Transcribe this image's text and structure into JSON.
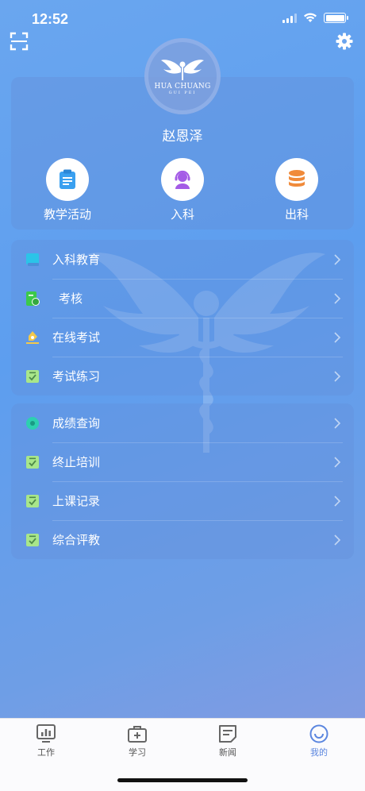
{
  "status_bar": {
    "time": "12:52"
  },
  "header": {
    "logo_text": "HUA CHUANG",
    "logo_sub": "GUI PEI"
  },
  "profile": {
    "name": "赵恩泽",
    "quick_actions": [
      {
        "label": "教学活动",
        "icon": "clipboard-icon",
        "color": "#3aa0f0"
      },
      {
        "label": "入科",
        "icon": "headset-person-icon",
        "color": "#a45be6"
      },
      {
        "label": "出科",
        "icon": "database-stack-icon",
        "color": "#f08a3a"
      }
    ]
  },
  "menu_group_1": [
    {
      "label": "入科教育",
      "icon": "book-icon",
      "color": "#2bc4e8"
    },
    {
      "label": "考核",
      "icon": "assessment-icon",
      "color": "#3cc94a"
    },
    {
      "label": "在线考试",
      "icon": "pen-icon",
      "color": "#f2c84b"
    },
    {
      "label": "考试练习",
      "icon": "checklist-icon",
      "color": "#a8e68a"
    }
  ],
  "menu_group_2": [
    {
      "label": "成绩查询",
      "icon": "score-icon",
      "color": "#2dd0b0"
    },
    {
      "label": "终止培训",
      "icon": "checklist-icon",
      "color": "#a8e68a"
    },
    {
      "label": "上课记录",
      "icon": "checklist-icon",
      "color": "#a8e68a"
    },
    {
      "label": "综合评教",
      "icon": "checklist-icon",
      "color": "#a8e68a"
    }
  ],
  "tab_bar": {
    "tabs": [
      {
        "label": "工作",
        "icon": "chart-board-icon"
      },
      {
        "label": "学习",
        "icon": "medical-kit-icon"
      },
      {
        "label": "新闻",
        "icon": "news-icon"
      },
      {
        "label": "我的",
        "icon": "smile-icon"
      }
    ],
    "active": "我的",
    "active_color": "#5b86df"
  }
}
